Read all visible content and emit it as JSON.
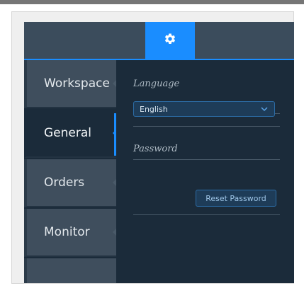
{
  "header": {
    "settings_icon": "gear-icon"
  },
  "sidebar": {
    "items": [
      {
        "label": "Workspace",
        "active": false
      },
      {
        "label": "General",
        "active": true
      },
      {
        "label": "Orders",
        "active": false
      },
      {
        "label": "Monitor",
        "active": false
      },
      {
        "label": "",
        "active": false
      }
    ]
  },
  "general": {
    "language_label": "Language",
    "language_value": "English",
    "password_label": "Password",
    "reset_password_label": "Reset Password"
  },
  "colors": {
    "accent": "#1a8dff",
    "panel_bg": "#1b2b3a",
    "sidebar_bg": "#3f4e5d"
  }
}
